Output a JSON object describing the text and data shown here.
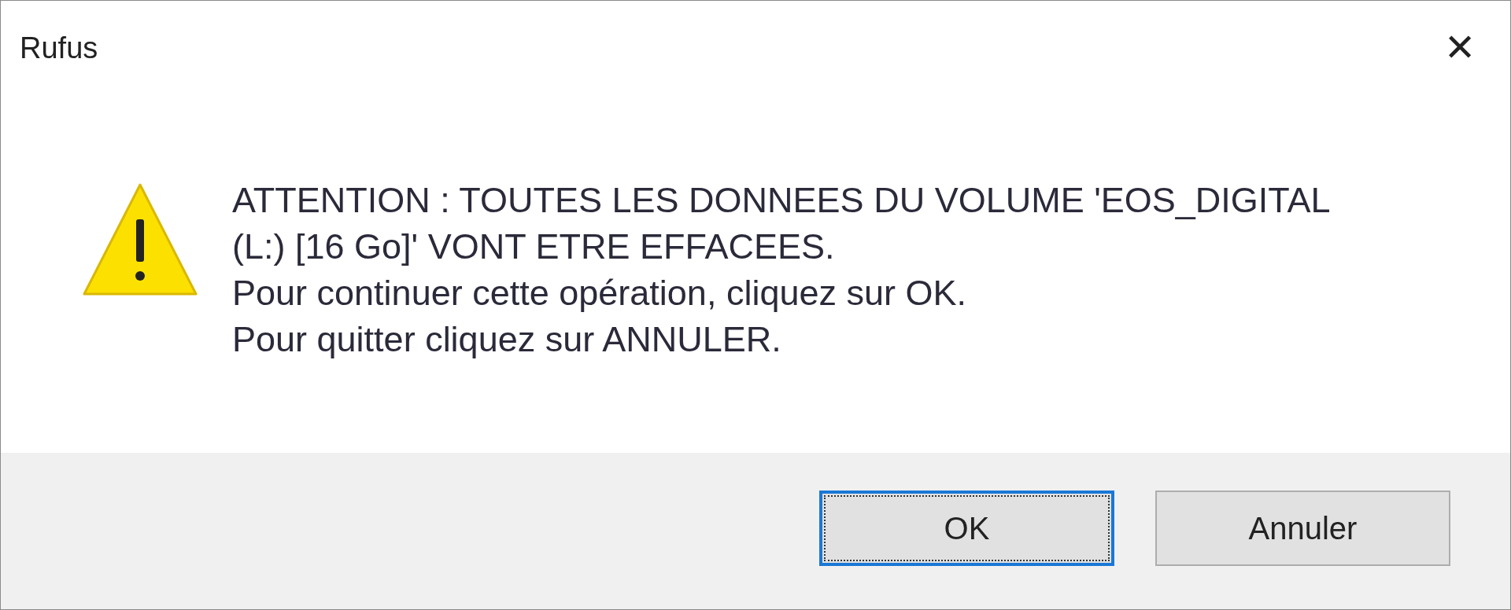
{
  "window": {
    "title": "Rufus",
    "close": "✕"
  },
  "message": {
    "lines": [
      "ATTENTION : TOUTES LES DONNEES DU VOLUME 'EOS_DIGITAL",
      "(L:) [16 Go]' VONT ETRE EFFACEES.",
      "Pour continuer cette opération, cliquez sur OK.",
      "Pour quitter cliquez sur ANNULER."
    ]
  },
  "buttons": [
    {
      "label": "OK",
      "selected": true
    },
    {
      "label": "Annuler",
      "selected": false
    }
  ]
}
